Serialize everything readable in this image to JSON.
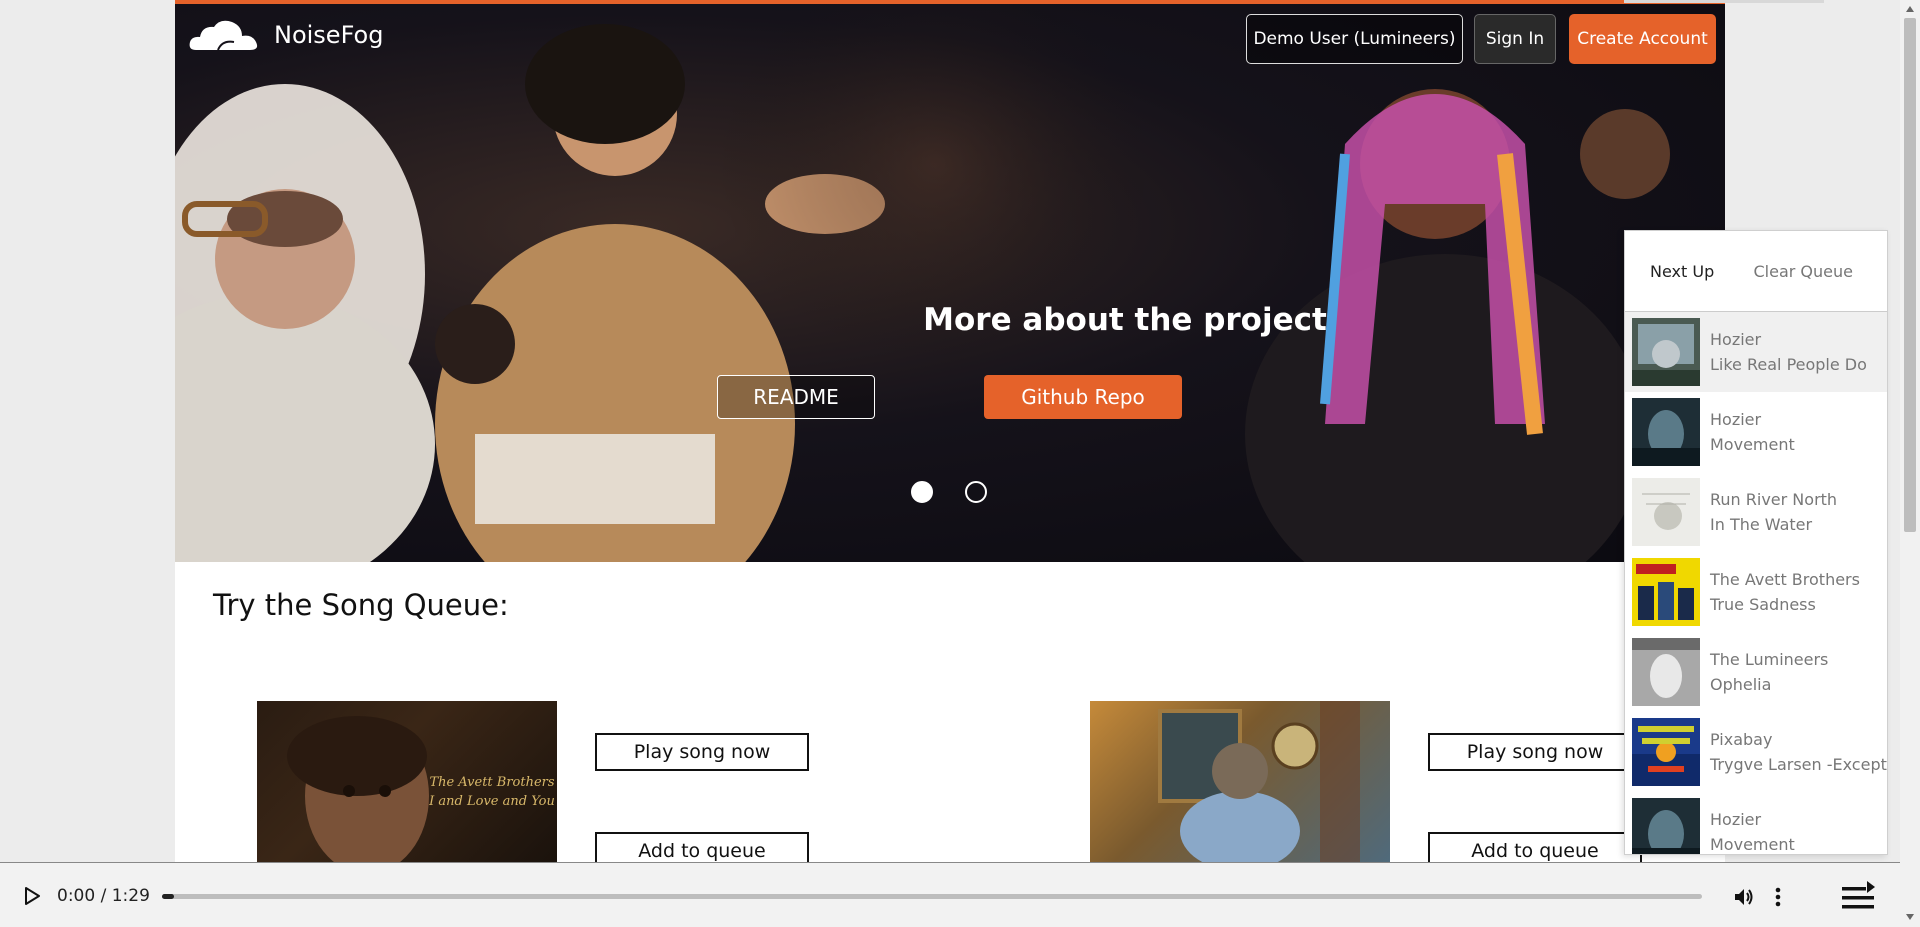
{
  "brand": {
    "name": "NoiseFog"
  },
  "header": {
    "demo_label": "Demo User (Lumineers)",
    "signin_label": "Sign In",
    "create_label": "Create Account"
  },
  "hero": {
    "title": "More about the project",
    "readme_label": "README",
    "github_label": "Github Repo",
    "slides": 2,
    "active_slide": 1
  },
  "section": {
    "title": "Try the Song Queue:"
  },
  "songs": [
    {
      "album_text": "The Avett Brothers\nI and Love and You",
      "play_label": "Play song now",
      "queue_label": "Add to queue"
    },
    {
      "album_text": "",
      "play_label": "Play song now",
      "queue_label": "Add to queue"
    }
  ],
  "album_art": {
    "line1": "The Avett Brothers",
    "line2": "I and Love and You"
  },
  "queue": {
    "next_label": "Next Up",
    "clear_label": "Clear Queue",
    "items": [
      {
        "artist": "Hozier",
        "title": "Like Real People Do",
        "active": true
      },
      {
        "artist": "Hozier",
        "title": "Movement",
        "active": false
      },
      {
        "artist": "Run River North",
        "title": "In The Water",
        "active": false
      },
      {
        "artist": "The Avett Brothers",
        "title": "True Sadness",
        "active": false
      },
      {
        "artist": "The Lumineers",
        "title": "Ophelia",
        "active": false
      },
      {
        "artist": "Pixabay",
        "title": "Trygve Larsen -Excepti",
        "active": false
      },
      {
        "artist": "Hozier",
        "title": "Movement",
        "active": false
      }
    ]
  },
  "player": {
    "time": "0:00 / 1:29",
    "progress": 0.0
  },
  "colors": {
    "accent": "#e5622a",
    "dark": "#111111"
  },
  "icons": [
    "cloud-logo-icon",
    "play-icon",
    "volume-icon",
    "more-vert-icon",
    "queue-list-icon"
  ]
}
